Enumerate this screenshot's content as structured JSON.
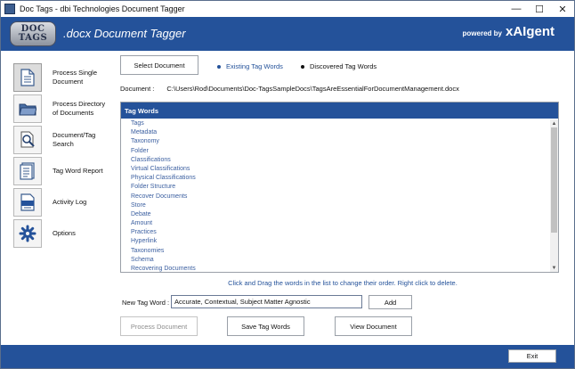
{
  "window": {
    "title": "Doc Tags - dbi Technologies Document Tagger",
    "minimize": "—",
    "maximize": "☐",
    "close": "✕"
  },
  "header": {
    "logo_line1": "DOC",
    "logo_line2": "TAGS",
    "title": ".docx Document Tagger",
    "powered_by": "powered by",
    "brand": "xAIgent"
  },
  "sidebar": {
    "items": [
      {
        "label": "Process Single Document",
        "icon": "document-icon"
      },
      {
        "label": "Process Directory of Documents",
        "icon": "folder-icon"
      },
      {
        "label": "Document/Tag Search",
        "icon": "magnifier-document-icon"
      },
      {
        "label": "Tag Word Report",
        "icon": "report-icon"
      },
      {
        "label": "Activity Log",
        "icon": "log-icon"
      },
      {
        "label": "Options",
        "icon": "gear-icon"
      }
    ]
  },
  "main": {
    "select_document": "Select Document",
    "radio_existing": "Existing Tag Words",
    "radio_discovered": "Discovered Tag Words",
    "document_label": "Document :",
    "document_path": "C:\\Users\\Rod\\Documents\\Doc-TagsSampleDocs\\TagsAreEssentialForDocumentManagement.docx",
    "list_header": "Tag Words",
    "tags": [
      "Tags",
      "Metadata",
      "Taxonomy",
      "Folder",
      "Classifications",
      "Virtual Classifications",
      "Physical Classifications",
      "Folder Structure",
      "Recover Documents",
      "Store",
      "Debate",
      "Amount",
      "Practices",
      "Hyperlink",
      "Taxonomies",
      "Schema",
      "Recovering Documents"
    ],
    "hint": "Click and Drag the words in the list to change their order. Right click to delete.",
    "new_tag_label": "New Tag Word :",
    "new_tag_value": "Accurate, Contextual, Subject Matter Agnostic",
    "add": "Add",
    "process_document": "Process Document",
    "save_tag_words": "Save Tag Words",
    "view_document": "View Document"
  },
  "footer": {
    "exit": "Exit"
  },
  "colors": {
    "accent": "#24529a",
    "tag_text": "#3b5fa0"
  }
}
